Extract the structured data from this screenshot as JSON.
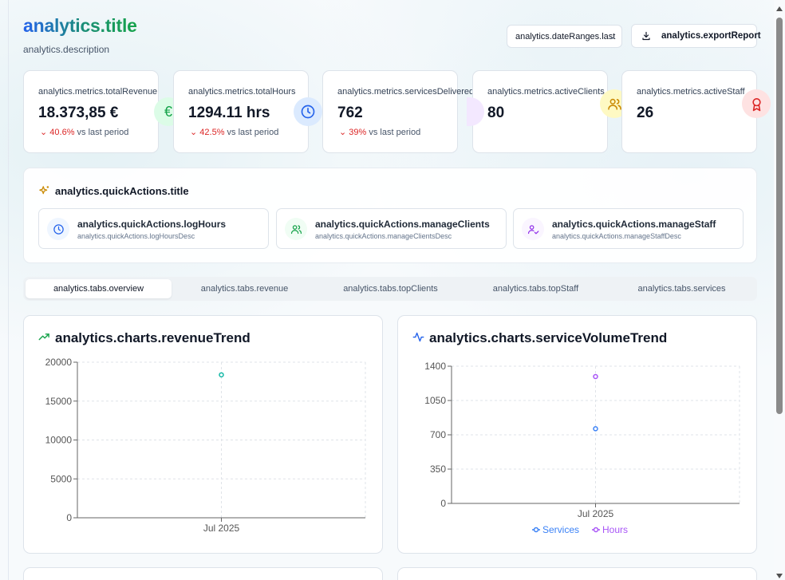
{
  "header": {
    "title": "analytics.title",
    "description": "analytics.description",
    "date_range_value": "analytics.dateRanges.last",
    "export_label": "analytics.exportReport"
  },
  "metrics": [
    {
      "label": "analytics.metrics.totalRevenue",
      "value": "18.373,85 €",
      "change": "40.6%",
      "change_suffix": "vs last period",
      "icon": "euro-icon",
      "color": "#16a34a"
    },
    {
      "label": "analytics.metrics.totalHours",
      "value": "1294.11 hrs",
      "change": "42.5%",
      "change_suffix": "vs last period",
      "icon": "clock-icon",
      "color": "#2563eb"
    },
    {
      "label": "analytics.metrics.servicesDelivered",
      "value": "762",
      "change": "39%",
      "change_suffix": "vs last period",
      "icon": "sparkle-icon",
      "color": "#9333ea"
    },
    {
      "label": "analytics.metrics.activeClients",
      "value": "80",
      "icon": "users-icon",
      "color": "#ca8a04"
    },
    {
      "label": "analytics.metrics.activeStaff",
      "value": "26",
      "icon": "award-icon",
      "color": "#dc2626"
    }
  ],
  "quick_actions": {
    "title": "analytics.quickActions.title",
    "items": [
      {
        "label": "analytics.quickActions.logHours",
        "desc": "analytics.quickActions.logHoursDesc",
        "icon": "clock-icon"
      },
      {
        "label": "analytics.quickActions.manageClients",
        "desc": "analytics.quickActions.manageClientsDesc",
        "icon": "users-icon"
      },
      {
        "label": "analytics.quickActions.manageStaff",
        "desc": "analytics.quickActions.manageStaffDesc",
        "icon": "user-check-icon"
      }
    ]
  },
  "tabs": [
    {
      "label": "analytics.tabs.overview",
      "active": true
    },
    {
      "label": "analytics.tabs.revenue"
    },
    {
      "label": "analytics.tabs.topClients"
    },
    {
      "label": "analytics.tabs.topStaff"
    },
    {
      "label": "analytics.tabs.services"
    }
  ],
  "charts": {
    "revenue_title": "analytics.charts.revenueTrend",
    "volume_title": "analytics.charts.serviceVolumeTrend"
  },
  "colors": {
    "revenue_line": "#14b8a6",
    "services_line": "#3b82f6",
    "hours_line": "#a855f7",
    "negative": "#dc2626"
  },
  "chart_data": [
    {
      "type": "line",
      "title": "analytics.charts.revenueTrend",
      "categories": [
        "Jul 2025"
      ],
      "series": [
        {
          "values": [
            18373.85
          ]
        }
      ],
      "ylim": [
        0,
        20000
      ],
      "yticks": [
        0,
        5000,
        10000,
        15000,
        20000
      ],
      "grid": true
    },
    {
      "type": "line",
      "title": "analytics.charts.serviceVolumeTrend",
      "categories": [
        "Jul 2025"
      ],
      "series": [
        {
          "name": "Services",
          "values": [
            762
          ]
        },
        {
          "name": "Hours",
          "values": [
            1294.11
          ]
        }
      ],
      "ylim": [
        0,
        1400
      ],
      "yticks": [
        0,
        350,
        700,
        1050,
        1400
      ],
      "grid": true,
      "legend": "bottom"
    }
  ]
}
